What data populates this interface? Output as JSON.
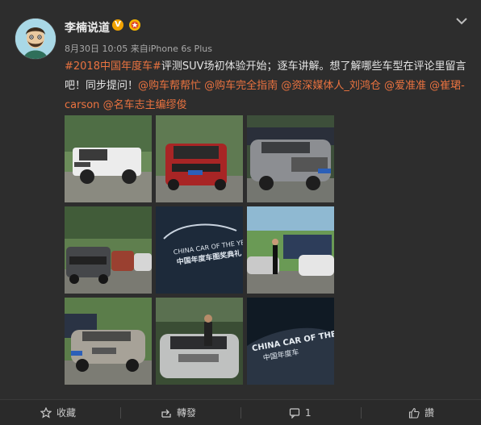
{
  "post": {
    "username": "李楠说道",
    "verified_badge": "V",
    "date": "8月30日 10:05",
    "source_prefix": " 来自",
    "source": "iPhone 6s Plus",
    "text": {
      "hashtag": "#2018中国年度车#",
      "line": "评测SUV场初体验开始；逐车讲解。想了解哪些车型在评论里留言吧！同步提问！",
      "mentions": [
        "@购车帮帮忙",
        "@购车完全指南",
        "@资深媒体人_刘鸿仓",
        "@爱准准",
        "@崔珺-carson",
        "@名车志主编缪俊"
      ]
    }
  },
  "photos": [
    {
      "alt": "white pickup truck"
    },
    {
      "alt": "red SUV"
    },
    {
      "alt": "grey SUV"
    },
    {
      "alt": "cars in park"
    },
    {
      "alt": "China Car of the Year sign",
      "sign_en": "CHINA CAR OF THE YEAR",
      "sign_cn": "中国年度车图奖典礼"
    },
    {
      "alt": "white SUV"
    },
    {
      "alt": "silver SUV"
    },
    {
      "alt": "silver SUV front"
    },
    {
      "alt": "CHINA CAR OF THE YEAR banner",
      "sign_en": "CHINA CAR OF THE YEAR",
      "sign_cn": "中国年度车"
    }
  ],
  "footer": {
    "favorite": "收藏",
    "repost": "轉發",
    "comment": "1",
    "like": "讚"
  },
  "colors": {
    "background": "#2d2d2d",
    "link": "#eb7340",
    "badge": "#f2a300"
  }
}
